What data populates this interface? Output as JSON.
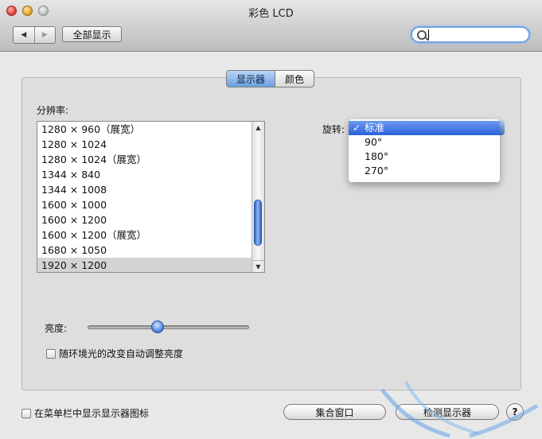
{
  "window": {
    "title": "彩色 LCD"
  },
  "toolbar": {
    "back_icon": "left-triangle-icon",
    "forward_icon": "right-triangle-icon",
    "back_glyph": "◀",
    "forward_glyph": "▶",
    "show_all_label": "全部显示",
    "search_value": ""
  },
  "tabs": [
    {
      "label": "显示器",
      "active": true
    },
    {
      "label": "颜色",
      "active": false
    }
  ],
  "resolution": {
    "label": "分辨率:",
    "items": [
      "1280 × 960（展宽）",
      "1280 × 1024",
      "1280 × 1024（展宽）",
      "1344 × 840",
      "1344 × 1008",
      "1600 × 1000",
      "1600 × 1200",
      "1600 × 1200（展宽）",
      "1680 × 1050",
      "1920 × 1200"
    ],
    "selected": "1920 × 1200"
  },
  "rotation": {
    "label": "旋转:",
    "options": [
      "标准",
      "90°",
      "180°",
      "270°"
    ],
    "selected": "标准",
    "check_glyph": "✓"
  },
  "brightness": {
    "label": "亮度:",
    "level": 0.43,
    "auto_adjust_label": "随环境光的改变自动调整亮度",
    "auto_adjust_checked": false
  },
  "bottom": {
    "menubar_icon_label": "在菜单栏中显示显示器图标",
    "menubar_icon_checked": false,
    "gather_windows_label": "集合窗口",
    "detect_displays_label": "检测显示器",
    "help_glyph": "?"
  },
  "colors": {
    "accent": "#3f7fd8",
    "selection_gray": "#d4d4d4",
    "window_bg": "#e8e8e8"
  }
}
